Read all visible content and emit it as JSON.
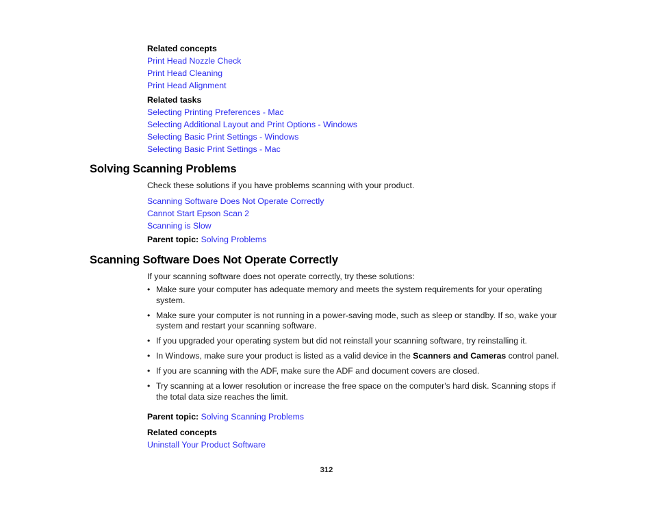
{
  "document": {
    "page_number": "312",
    "link_color": "#2c2cf0",
    "text_color": "#1a1a1a"
  },
  "top_related_concepts": {
    "heading": "Related concepts",
    "links": [
      "Print Head Nozzle Check",
      "Print Head Cleaning",
      "Print Head Alignment"
    ]
  },
  "top_related_tasks": {
    "heading": "Related tasks",
    "links": [
      "Selecting Printing Preferences - Mac",
      "Selecting Additional Layout and Print Options - Windows",
      "Selecting Basic Print Settings - Windows",
      "Selecting Basic Print Settings - Mac"
    ]
  },
  "solving_scanning_problems": {
    "title": "Solving Scanning Problems",
    "intro": "Check these solutions if you have problems scanning with your product.",
    "links": [
      "Scanning Software Does Not Operate Correctly",
      "Cannot Start Epson Scan 2",
      "Scanning is Slow"
    ],
    "parent_topic_label": "Parent topic:",
    "parent_topic_link": "Solving Problems"
  },
  "scanning_software_section": {
    "title": "Scanning Software Does Not Operate Correctly",
    "intro": "If your scanning software does not operate correctly, try these solutions:",
    "bullet_marker": "•",
    "bullets": [
      {
        "pre": "Make sure your computer has adequate memory and meets the system requirements for your operating system.",
        "bold": "",
        "post": ""
      },
      {
        "pre": "Make sure your computer is not running in a power-saving mode, such as sleep or standby. If so, wake your system and restart your scanning software.",
        "bold": "",
        "post": ""
      },
      {
        "pre": "If you upgraded your operating system but did not reinstall your scanning software, try reinstalling it.",
        "bold": "",
        "post": ""
      },
      {
        "pre": "In Windows, make sure your product is listed as a valid device in the ",
        "bold": "Scanners and Cameras",
        "post": " control panel."
      },
      {
        "pre": "If you are scanning with the ADF, make sure the ADF and document covers are closed.",
        "bold": "",
        "post": ""
      },
      {
        "pre": "Try scanning at a lower resolution or increase the free space on the computer's hard disk. Scanning stops if the total data size reaches the limit.",
        "bold": "",
        "post": ""
      }
    ],
    "parent_topic_label": "Parent topic:",
    "parent_topic_link": "Solving Scanning Problems",
    "related_concepts_heading": "Related concepts",
    "related_concepts_links": [
      "Uninstall Your Product Software"
    ]
  }
}
